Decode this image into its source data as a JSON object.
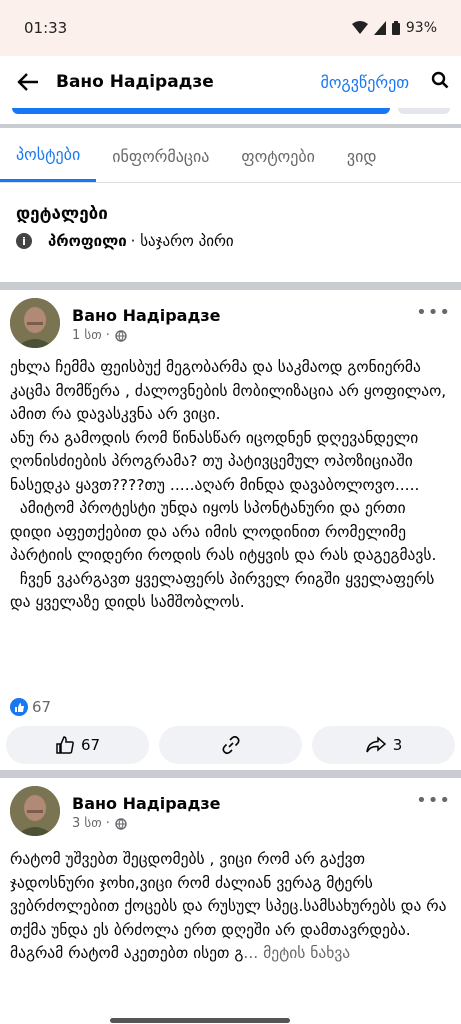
{
  "status_bar": {
    "time": "01:33",
    "battery": "93%"
  },
  "header": {
    "name": "Вано Надiрадзе",
    "message_label": "მოგვწერეთ"
  },
  "tabs": [
    {
      "label": "პოსტები",
      "active": true
    },
    {
      "label": "ინფორმაცია",
      "active": false
    },
    {
      "label": "ფოტოები",
      "active": false
    },
    {
      "label": "ვიდ",
      "active": false
    }
  ],
  "details": {
    "title": "დეტალები",
    "profile_label": "პროფილი",
    "profile_type": "· საჯარო პირი"
  },
  "posts": [
    {
      "author": "Вано Надiрадзе",
      "time": "1 სთ ·",
      "body": "ეხლა ჩემმა ფეისბუქ მეგობარმა და საკმაოდ გონიერმა კაცმა მომწერა , ძალოვნების მობილიზაცია არ ყოფილაო, ამით რა დავასკვნა არ ვიცი.\nანუ რა გამოდის რომ წინასწარ იცოდნენ დღევანდელი ღონისძიების პროგრამა? თუ პატივცემულ ოპოზიციაში ნასედკა ყავთ????თუ .....აღარ მინდა დავაბოლოვო.....\n  ამიტომ პროტესტი უნდა იყოს სპონტანური და ერთი დიდი აფეთქებით და არა იმის ლოდინით რომელიმე პარტიის ლიდერი როდის რას იტყვის და რას დაგეგმავს.\n  ჩვენ ვკარგავთ ყველაფერს პირველ რიგში ყველაფერს და ყველაზე დიდს სამშობლოს.",
      "reactions": "67",
      "like_count": "67",
      "share_count": "3"
    },
    {
      "author": "Вано Надiрадзе",
      "time": "3 სთ ·",
      "body": "რატომ უშვებთ შეცდომებს , ვიცი რომ არ გაქვთ ჯადოსნური ჯოხი,ვიცი რომ ძალიან ვერაგ მტერს ვებრძოლებით ქოცებს და რუსულ სპეც.სამსახურებს და რა თქმა უნდა ეს ბრძოლა ერთ დღეში არ დამთავრდება. მაგრამ რატომ აკეთებთ ისეთ გ",
      "see_more": "... მეტის ნახვა"
    }
  ]
}
